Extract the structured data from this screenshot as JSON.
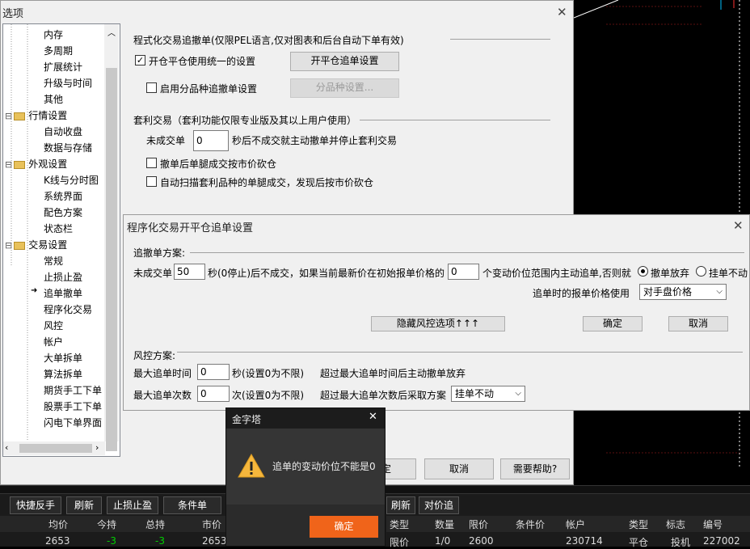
{
  "colors": {
    "accent": "#f0641a",
    "green": "#00d000",
    "dark_bg": "#000000"
  },
  "options_window": {
    "title": "选项",
    "tree": [
      {
        "label": "内存",
        "level": 2
      },
      {
        "label": "多周期",
        "level": 2
      },
      {
        "label": "扩展统计",
        "level": 2
      },
      {
        "label": "升级与时间",
        "level": 2
      },
      {
        "label": "其他",
        "level": 2
      },
      {
        "label": "行情设置",
        "level": 1
      },
      {
        "label": "自动收盘",
        "level": 2
      },
      {
        "label": "数据与存储",
        "level": 2
      },
      {
        "label": "外观设置",
        "level": 1
      },
      {
        "label": "K线与分时图",
        "level": 2
      },
      {
        "label": "系统界面",
        "level": 2
      },
      {
        "label": "配色方案",
        "level": 2
      },
      {
        "label": "状态栏",
        "level": 2
      },
      {
        "label": "交易设置",
        "level": 1
      },
      {
        "label": "常规",
        "level": 2
      },
      {
        "label": "止损止盈",
        "level": 2
      },
      {
        "label": "追单撤单",
        "level": 2
      },
      {
        "label": "程序化交易",
        "level": 2
      },
      {
        "label": "风控",
        "level": 2
      },
      {
        "label": "帐户",
        "level": 2
      },
      {
        "label": "大单拆单",
        "level": 2
      },
      {
        "label": "算法拆单",
        "level": 2
      },
      {
        "label": "期货手工下单",
        "level": 2
      },
      {
        "label": "股票手工下单",
        "level": 2
      },
      {
        "label": "闪电下单界面",
        "level": 2
      }
    ],
    "prog_section_title": "程式化交易追撤单(仅限PEL语言,仅对图表和后台自动下单有效)",
    "cb_unified": "开仓平仓使用统一的设置",
    "btn_open_close": "开平仓追单设置",
    "cb_by_variety": "启用分品种追撤单设置",
    "btn_by_variety": "分品种设置...",
    "arb_title": "套利交易（套利功能仅限专业版及其以上用户使用）",
    "arb_unfilled_label": "未成交单",
    "arb_unfilled_value": "0",
    "arb_unfilled_suffix": "秒后不成交就主动撤单并停止套利交易",
    "cb_cancel_leg": "撤单后单腿成交按市价砍仓",
    "cb_auto_scan": "自动扫描套利品种的单腿成交，发现后按市价砍仓",
    "btn_ok_partial": "定",
    "btn_cancel": "取消",
    "btn_help": "需要帮助?"
  },
  "chase_dialog": {
    "title": "程序化交易开平仓追单设置",
    "chase_plan_label": "追撤单方案:",
    "unfilled_label": "未成交单",
    "unfilled_value": "50",
    "unfilled_mid": "秒(0停止)后不成交，如果当前最新价在初始报单价格的",
    "ticks_value": "0",
    "ticks_suffix": "个变动价位范围内主动追单,否则就",
    "radio_cancel": "撤单放弃",
    "radio_hang": "挂单不动",
    "price_label": "追单时的报单价格使用",
    "price_select": "对手盘价格",
    "btn_hide_risk": "隐藏风控选项↑↑↑",
    "btn_ok": "确定",
    "btn_cancel": "取消",
    "risk_label": "风控方案:",
    "max_time_label": "最大追单时间",
    "max_time_value": "0",
    "max_time_suffix": "秒(设置0为不限)",
    "max_time_desc": "超过最大追单时间后主动撤单放弃",
    "max_count_label": "最大追单次数",
    "max_count_value": "0",
    "max_count_suffix": "次(设置0为不限)",
    "max_count_desc": "超过最大追单次数后采取方案",
    "max_count_select": "挂单不动"
  },
  "alert": {
    "title": "金字塔",
    "message": "追单的变动价位不能是0",
    "ok": "确定",
    "icon": "warning-icon"
  },
  "bottom": {
    "toolbar_left": [
      "快捷反手",
      "刷新",
      "止损止盈",
      "条件单"
    ],
    "toolbar_right": [
      "刷新",
      "对价追"
    ],
    "left_headers": [
      "均价",
      "今持",
      "总持",
      "市价"
    ],
    "left_row": [
      "2653",
      "-3",
      "-3",
      "2653"
    ],
    "right_headers": [
      "类型",
      "数量",
      "限价",
      "条件价",
      "帐户",
      "类型",
      "标志",
      "编号"
    ],
    "right_row": [
      "限价",
      "1/0",
      "2600",
      "",
      "230714",
      "平仓",
      "投机",
      "227002"
    ]
  }
}
